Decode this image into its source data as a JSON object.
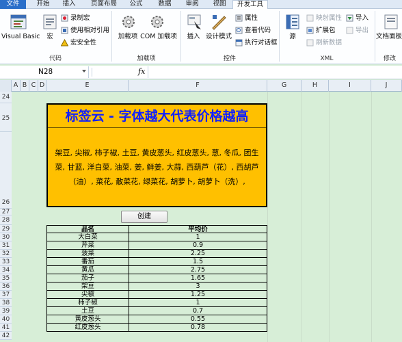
{
  "ribbon_tabs": [
    "文件",
    "开始",
    "插入",
    "页面布局",
    "公式",
    "数据",
    "审阅",
    "视图",
    "开发工具"
  ],
  "ribbon": {
    "vb_label": "Visual Basic",
    "macro_label": "宏",
    "record_macro": "录制宏",
    "relative_ref": "使用相对引用",
    "macro_security": "宏安全性",
    "group_code": "代码",
    "addins_label": "加载项",
    "com_addins_label": "COM 加载项",
    "group_addins": "加载项",
    "insert_label": "插入",
    "design_mode_label": "设计模式",
    "properties": "属性",
    "view_code": "查看代码",
    "run_dialog": "执行对话框",
    "group_controls": "控件",
    "source_label": "源",
    "map_properties": "映射属性",
    "expansion_pack": "扩展包",
    "refresh_data": "刷新数据",
    "import": "导入",
    "export": "导出",
    "group_xml": "XML",
    "doc_panel_label": "文档面板",
    "group_modify": "修改"
  },
  "formula_bar": {
    "name_box": "N28",
    "fx": "fx",
    "value": ""
  },
  "columns": [
    "A",
    "B",
    "C",
    "D",
    "E",
    "F",
    "G",
    "H",
    "I",
    "J"
  ],
  "rows": [
    "24",
    "25",
    "26",
    "27",
    "28",
    "29",
    "30",
    "31",
    "32",
    "33",
    "34",
    "35",
    "36",
    "37",
    "38",
    "39",
    "40",
    "41",
    "42",
    "43",
    "44"
  ],
  "tag_cloud": {
    "title": "标签云 - 字体越大代表价格越高",
    "text": "架豆, 尖椒, 柿子椒, 土豆, 黄皮葱头, 红皮葱头, 葱, 冬瓜, 团生菜, 甘蓝, 洋白菜, 油菜, 姜, 鲜姜, 大蒜, 西葫芦（花）, 西胡芦（油）, 菜花, 散菜花, 绿菜花, 胡萝卜, 胡萝卜（洗）,"
  },
  "create_button": "创建",
  "table": {
    "headers": [
      "品名",
      "平均价"
    ],
    "rows": [
      [
        "大白菜",
        "1"
      ],
      [
        "芹菜",
        "0.9"
      ],
      [
        "菠菜",
        "2.25"
      ],
      [
        "番茄",
        "1.5"
      ],
      [
        "黄瓜",
        "2.75"
      ],
      [
        "茄子",
        "1.65"
      ],
      [
        "架豆",
        "3"
      ],
      [
        "尖椒",
        "1.25"
      ],
      [
        "柿子椒",
        "1"
      ],
      [
        "土豆",
        "0.7"
      ],
      [
        "黄皮葱头",
        "0.55"
      ],
      [
        "红皮葱头",
        "0.78"
      ]
    ]
  },
  "colors": {
    "accent": "#2a6fc9",
    "title_blue": "#1020ff",
    "cloud_bg": "#ffc000",
    "sheet_bg": "#d7eed7"
  }
}
